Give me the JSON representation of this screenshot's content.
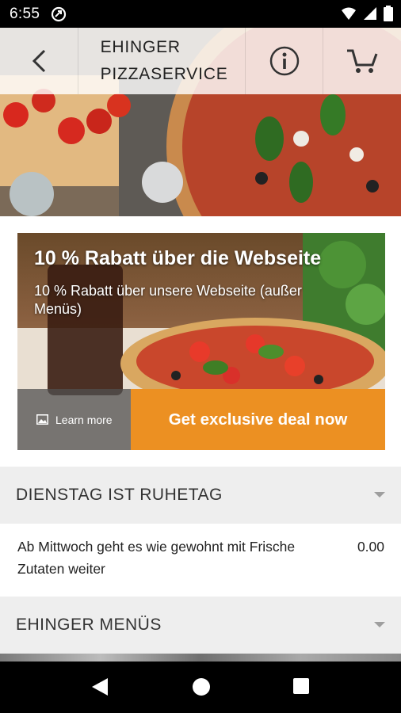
{
  "status_bar": {
    "time": "6:55"
  },
  "header": {
    "title": "EHINGER\nPIZZASERVICE",
    "icons": [
      "back-arrow-icon",
      "info-icon",
      "cart-icon"
    ]
  },
  "promo": {
    "title": "10 % Rabatt über die Webseite",
    "subtitle": "10 % Rabatt über unsere Webseite (außer Menüs)",
    "learn_more": "Learn more",
    "deal_button": "Get exclusive deal now"
  },
  "sections": [
    {
      "title": "DIENSTAG IST RUHETAG",
      "items": [
        {
          "name": "Ab Mittwoch geht es wie gewohnt mit Frische Zutaten weiter",
          "price": "0.00"
        }
      ]
    },
    {
      "title": "EHINGER MENÜS",
      "items": []
    }
  ],
  "colors": {
    "accent": "#ec9022",
    "section_bg": "#eeeeee"
  }
}
